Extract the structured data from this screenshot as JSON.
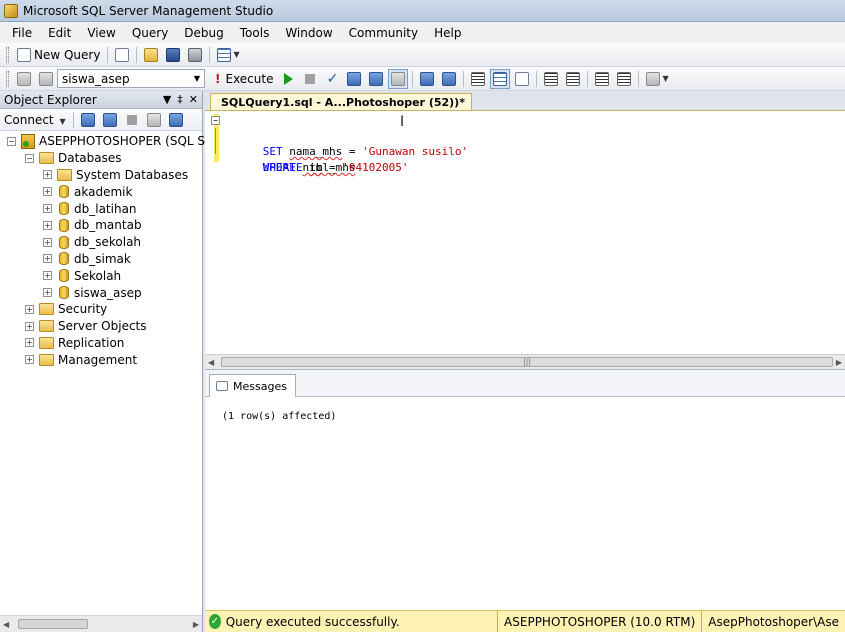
{
  "window": {
    "title": "Microsoft SQL Server Management Studio"
  },
  "menu": [
    "File",
    "Edit",
    "View",
    "Query",
    "Debug",
    "Tools",
    "Window",
    "Community",
    "Help"
  ],
  "toolbar": {
    "new_query_label": "New Query"
  },
  "query_toolbar": {
    "database": "siswa_asep",
    "execute_label": "Execute"
  },
  "object_explorer": {
    "title": "Object Explorer",
    "connect_label": "Connect",
    "server": "ASEPPHOTOSHOPER (SQL Serve",
    "databases_label": "Databases",
    "databases": [
      "System Databases",
      "akademik",
      "db_latihan",
      "db_mantab",
      "db_sekolah",
      "db_simak",
      "Sekolah",
      "siswa_asep"
    ],
    "other_nodes": [
      "Security",
      "Server Objects",
      "Replication",
      "Management"
    ]
  },
  "editor": {
    "tab_label": "SQLQuery1.sql - A...Photoshoper (52))*",
    "line1": {
      "kw": "UPDATE",
      "rest": "tbl_mhs"
    },
    "line2": {
      "kw": "SET",
      "col": "nama_mhs",
      "op": "=",
      "val": "'Gunawan susilo'"
    },
    "line3": {
      "kw": "WHERE",
      "col": "nim",
      "op": "=",
      "val": "'04102005'"
    }
  },
  "results": {
    "tab_label": "Messages",
    "message": "(1 row(s) affected)"
  },
  "status": {
    "message": "Query executed successfully.",
    "server": "ASEPPHOTOSHOPER (10.0 RTM)",
    "user": "AsepPhotoshoper\\Ase"
  }
}
